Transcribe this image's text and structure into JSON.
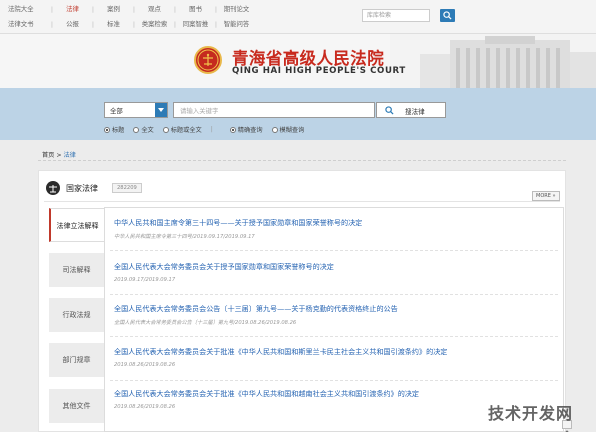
{
  "topnav": {
    "row1": [
      "法院大全",
      "法律",
      "案例",
      "观点",
      "图书",
      "期刊论文"
    ],
    "row2": [
      "法律文书",
      "公报",
      "标准",
      "类案检索",
      "同案智推",
      "智能问答"
    ],
    "search_placeholder": "库库检索"
  },
  "header": {
    "court_name_cn": "青海省高级人民法院",
    "court_name_en": "QING HAI HIGH PEOPLE'S COURT"
  },
  "search": {
    "scope_selected": "全部",
    "keyword_placeholder": "请输入关键字",
    "button_label": "搜法律",
    "options": [
      {
        "label": "标题",
        "checked": true
      },
      {
        "label": "全文",
        "checked": false
      },
      {
        "label": "标题或全文",
        "checked": false
      },
      {
        "label": "精确查询",
        "checked": true
      },
      {
        "label": "模糊查询",
        "checked": false
      }
    ]
  },
  "breadcrumb": {
    "home": "首页",
    "sep": ">",
    "current": "法律"
  },
  "section": {
    "title": "国家法律",
    "count": "282209",
    "more_label": "MORE »"
  },
  "tabs": [
    "法律立法解释",
    "司法解释",
    "行政法规",
    "部门规章",
    "其他文件"
  ],
  "items": [
    {
      "title": "中华人民共和国主席令第三十四号——关于授予国家勋章和国家荣誉称号的决定",
      "meta": "中华人民共和国主席令第三十四号/2019.09.17/2019.09.17"
    },
    {
      "title": "全国人民代表大会常务委员会关于授予国家勋章和国家荣誉称号的决定",
      "meta": "2019.09.17/2019.09.17"
    },
    {
      "title": "全国人民代表大会常务委员会公告〔十三届〕第九号——关于杨克勤的代表资格终止的公告",
      "meta": "全国人民代表大会常务委员会公告〔十三届〕第九号/2019.08.26/2019.08.26"
    },
    {
      "title": "全国人民代表大会常务委员会关于批准《中华人民共和国和斯里兰卡民主社会主义共和国引渡条约》的决定",
      "meta": "2019.08.26/2019.08.26"
    },
    {
      "title": "全国人民代表大会常务委员会关于批准《中华人民共和国和越南社会主义共和国引渡条约》的决定",
      "meta": "2019.08.26/2019.08.26"
    }
  ],
  "watermark": "技术开发网",
  "colors": {
    "accent_blue": "#2d7bb6",
    "court_red": "#c82a1e",
    "band": "#bcd3e6"
  }
}
